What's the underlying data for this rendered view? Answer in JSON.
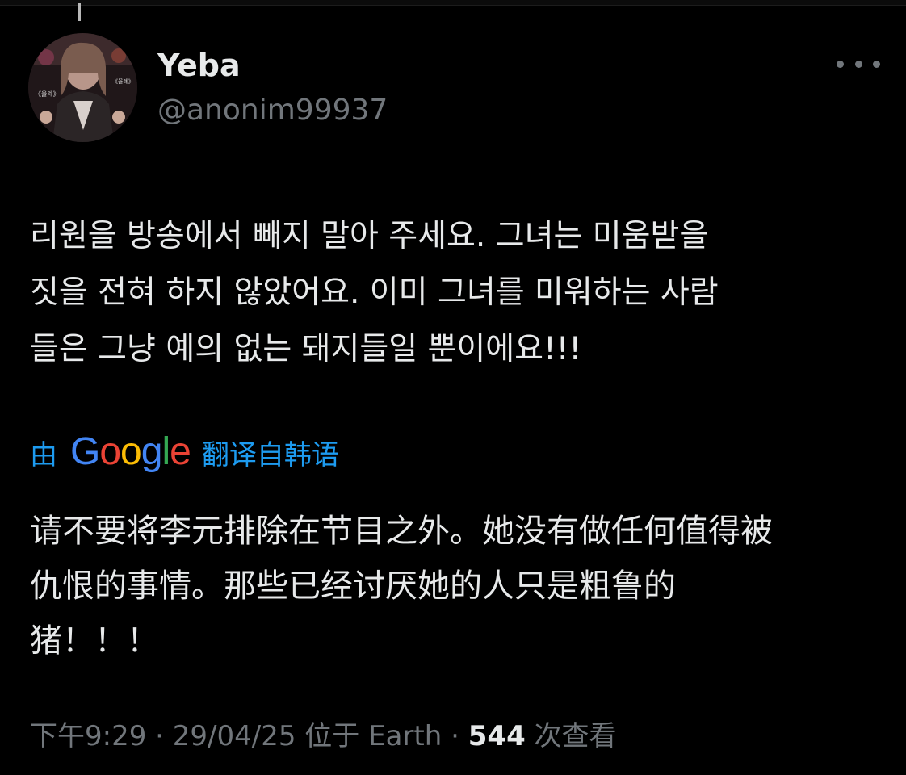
{
  "author": {
    "display_name": "Yeba",
    "handle": "@anonim99937",
    "avatar_icon": "profile-photo"
  },
  "tweet": {
    "text": "리원을 방송에서 빼지 말아 주세요. 그녀는 미움받을\n짓을 전혀 하지 않았어요. 이미 그녀를 미워하는 사람\n들은 그냥 예의 없는 돼지들일 뿐이에요!!!"
  },
  "translation": {
    "prefix": "由",
    "provider_letters": [
      "G",
      "o",
      "o",
      "g",
      "l",
      "e"
    ],
    "suffix": "翻译自韩语",
    "text": "请不要将李元排除在节目之外。她没有做任何值得被\n仇恨的事情。那些已经讨厌她的人只是粗鲁的\n猪！！！"
  },
  "meta": {
    "time": "下午9:29",
    "sep1": " · ",
    "date": "29/04/25",
    "location_prefix": " 位于 ",
    "location": "Earth",
    "sep2": " · ",
    "views_count": "544",
    "views_label": " 次查看"
  },
  "colors": {
    "background": "#000000",
    "primary_text": "#e7e9ea",
    "secondary_text": "#71767b",
    "link_blue": "#1d9bf0"
  }
}
